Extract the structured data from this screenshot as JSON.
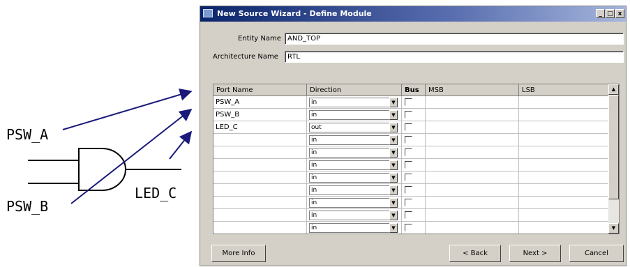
{
  "diagram": {
    "signals": {
      "in_a": "PSW_A",
      "in_b": "PSW_B",
      "out": "LED_C"
    }
  },
  "window": {
    "title": "New Source Wizard - Define Module",
    "controls": {
      "minimize": "_",
      "maximize": "□",
      "close": "x"
    }
  },
  "form": {
    "entity_label": "Entity Name",
    "entity_value": "AND_TOP",
    "arch_label": "Architecture Name",
    "arch_value": "RTL"
  },
  "table": {
    "headers": {
      "port": "Port Name",
      "direction": "Direction",
      "bus": "Bus",
      "msb": "MSB",
      "lsb": "LSB"
    },
    "rows": [
      {
        "port": "PSW_A",
        "direction": "in"
      },
      {
        "port": "PSW_B",
        "direction": "in"
      },
      {
        "port": "LED_C",
        "direction": "out"
      },
      {
        "port": "",
        "direction": "in"
      },
      {
        "port": "",
        "direction": "in"
      },
      {
        "port": "",
        "direction": "in"
      },
      {
        "port": "",
        "direction": "in"
      },
      {
        "port": "",
        "direction": "in"
      },
      {
        "port": "",
        "direction": "in"
      },
      {
        "port": "",
        "direction": "in"
      },
      {
        "port": "",
        "direction": "in"
      }
    ]
  },
  "buttons": {
    "more_info": "More Info",
    "back": "< Back",
    "next": "Next >",
    "cancel": "Cancel"
  }
}
